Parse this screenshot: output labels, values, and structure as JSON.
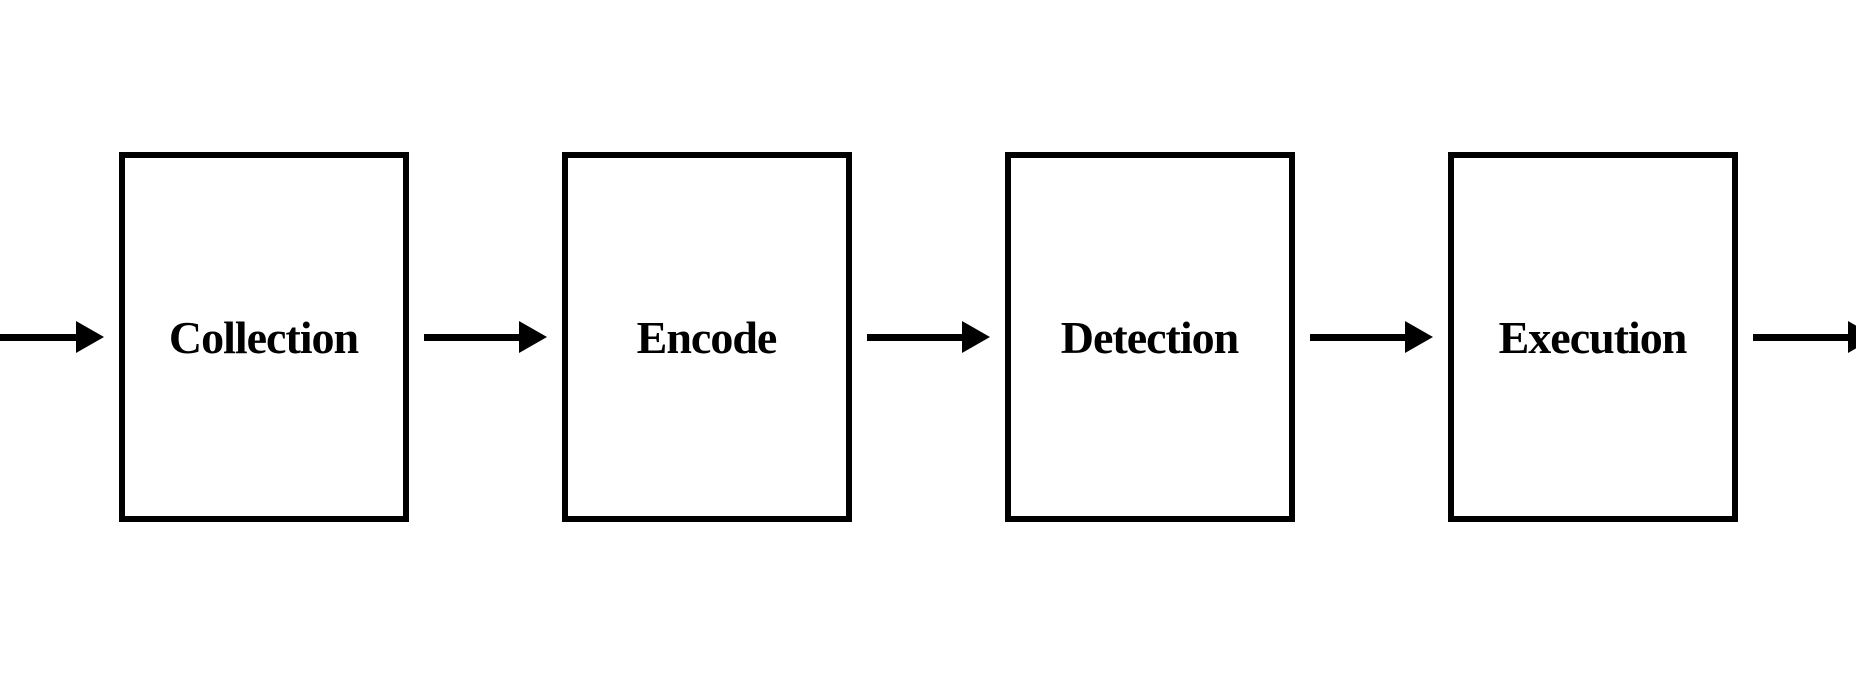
{
  "flow": {
    "boxes": [
      {
        "label": "Collection"
      },
      {
        "label": "Encode"
      },
      {
        "label": "Detection"
      },
      {
        "label": "Execution"
      }
    ]
  }
}
